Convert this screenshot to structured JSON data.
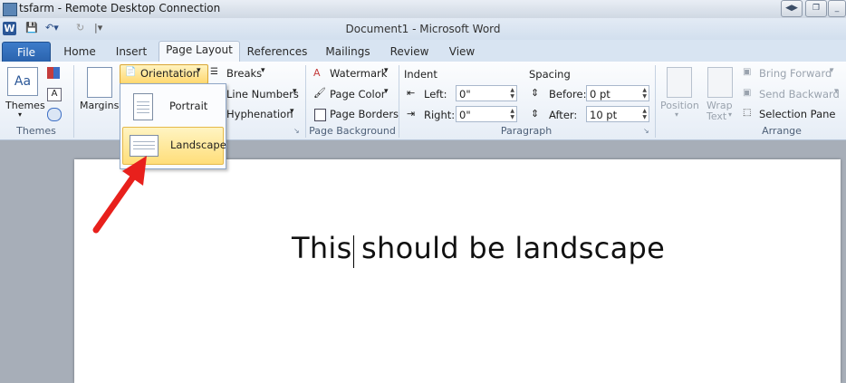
{
  "rdp": {
    "title": "tsfarm - Remote Desktop Connection"
  },
  "word": {
    "title": "Document1 - Microsoft Word",
    "logo": "W"
  },
  "tabs": [
    "File",
    "Home",
    "Insert",
    "Page Layout",
    "References",
    "Mailings",
    "Review",
    "View"
  ],
  "ribbon": {
    "themes": {
      "label": "Themes",
      "group": "Themes",
      "icon_text": "Aa"
    },
    "page_setup": {
      "margins": "Margins",
      "orientation": "Orientation",
      "breaks": "Breaks",
      "line_numbers": "Line Numbers",
      "hyphenation": "Hyphenation"
    },
    "page_background": {
      "group": "Page Background",
      "watermark": "Watermark",
      "page_color": "Page Color",
      "page_borders": "Page Borders"
    },
    "paragraph": {
      "group": "Paragraph",
      "indent": "Indent",
      "spacing": "Spacing",
      "left_label": "Left:",
      "right_label": "Right:",
      "before_label": "Before:",
      "after_label": "After:",
      "left_value": "0\"",
      "right_value": "0\"",
      "before_value": "0 pt",
      "after_value": "10 pt"
    },
    "arrange": {
      "group": "Arrange",
      "position": "Position",
      "wrap_text_1": "Wrap",
      "wrap_text_2": "Text",
      "bring_forward": "Bring Forward",
      "send_backward": "Send Backward",
      "selection_pane": "Selection Pane"
    }
  },
  "orientation_menu": {
    "items": [
      "Portrait",
      "Landscape"
    ],
    "hovered": "Landscape"
  },
  "document": {
    "text": "This should be landscape"
  },
  "colors": {
    "accent": "#2b5797",
    "highlight": "#ffde7a",
    "arrow": "#e8201c"
  }
}
